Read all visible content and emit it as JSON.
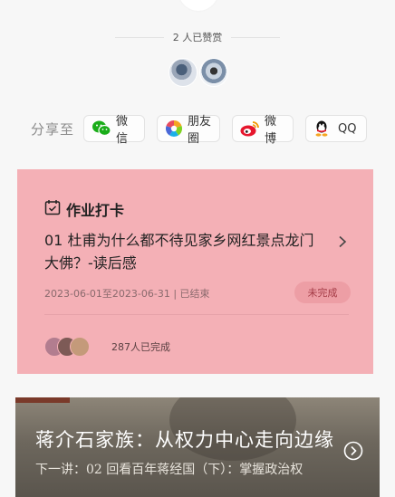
{
  "praise": {
    "text": "2 人已赞赏"
  },
  "share": {
    "label": "分享至",
    "buttons": [
      {
        "label": "微信",
        "icon": "wechat-icon"
      },
      {
        "label": "朋友圈",
        "icon": "moments-icon"
      },
      {
        "label": "微博",
        "icon": "weibo-icon"
      },
      {
        "label": "QQ",
        "icon": "qq-icon"
      }
    ]
  },
  "task": {
    "title": "作业打卡",
    "main_text": "01  杜甫为什么都不待见家乡网红景点龙门大佛？-读后感",
    "meta": "2023-06-01至2023-06-31 | 已结束",
    "status": "未完成",
    "completed": "287人已完成"
  },
  "course": {
    "title": "蒋介石家族：从权力中心走向边缘",
    "subtitle": "下一讲：02 回看百年蒋经国（下）：掌握政治权"
  },
  "colors": {
    "task_bg": "#f4b0b6",
    "wechat": "#1aad19",
    "weibo": "#e6162d"
  }
}
